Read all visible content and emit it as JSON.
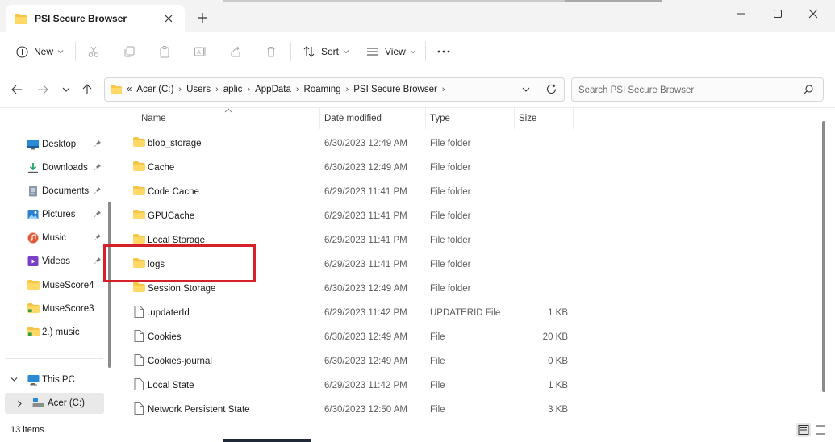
{
  "window": {
    "tab_title": "PSI Secure Browser"
  },
  "toolbar": {
    "new_label": "New",
    "sort_label": "Sort",
    "view_label": "View"
  },
  "address": {
    "overflow": "«",
    "crumbs": [
      "Acer (C:)",
      "Users",
      "aplic",
      "AppData",
      "Roaming",
      "PSI Secure Browser"
    ]
  },
  "search": {
    "placeholder": "Search PSI Secure Browser"
  },
  "sidebar": {
    "quick_access": [
      {
        "label": "Desktop",
        "icon": "desktop-icon",
        "pinned": true
      },
      {
        "label": "Downloads",
        "icon": "downloads-icon",
        "pinned": true
      },
      {
        "label": "Documents",
        "icon": "documents-icon",
        "pinned": true
      },
      {
        "label": "Pictures",
        "icon": "pictures-icon",
        "pinned": true
      },
      {
        "label": "Music",
        "icon": "music-icon",
        "pinned": true
      },
      {
        "label": "Videos",
        "icon": "videos-icon",
        "pinned": true
      },
      {
        "label": "MuseScore4",
        "icon": "folder-icon",
        "pinned": false
      },
      {
        "label": "MuseScore3",
        "icon": "folder-icon",
        "pinned": false
      },
      {
        "label": "2.) music",
        "icon": "folder-icon",
        "pinned": false
      }
    ],
    "this_pc": "This PC",
    "drive": "Acer (C:)"
  },
  "columns": {
    "name": "Name",
    "date": "Date modified",
    "type": "Type",
    "size": "Size"
  },
  "files": [
    {
      "name": "blob_storage",
      "date": "6/30/2023 12:49 AM",
      "type": "File folder",
      "size": "",
      "kind": "folder"
    },
    {
      "name": "Cache",
      "date": "6/30/2023 12:49 AM",
      "type": "File folder",
      "size": "",
      "kind": "folder"
    },
    {
      "name": "Code Cache",
      "date": "6/29/2023 11:41 PM",
      "type": "File folder",
      "size": "",
      "kind": "folder"
    },
    {
      "name": "GPUCache",
      "date": "6/29/2023 11:41 PM",
      "type": "File folder",
      "size": "",
      "kind": "folder"
    },
    {
      "name": "Local Storage",
      "date": "6/29/2023 11:41 PM",
      "type": "File folder",
      "size": "",
      "kind": "folder"
    },
    {
      "name": "logs",
      "date": "6/29/2023 11:41 PM",
      "type": "File folder",
      "size": "",
      "kind": "folder"
    },
    {
      "name": "Session Storage",
      "date": "6/30/2023 12:49 AM",
      "type": "File folder",
      "size": "",
      "kind": "folder"
    },
    {
      "name": ".updaterId",
      "date": "6/29/2023 11:42 PM",
      "type": "UPDATERID File",
      "size": "1 KB",
      "kind": "file"
    },
    {
      "name": "Cookies",
      "date": "6/30/2023 12:49 AM",
      "type": "File",
      "size": "20 KB",
      "kind": "file"
    },
    {
      "name": "Cookies-journal",
      "date": "6/30/2023 12:49 AM",
      "type": "File",
      "size": "0 KB",
      "kind": "file"
    },
    {
      "name": "Local State",
      "date": "6/29/2023 11:42 PM",
      "type": "File",
      "size": "1 KB",
      "kind": "file"
    },
    {
      "name": "Network Persistent State",
      "date": "6/30/2023 12:50 AM",
      "type": "File",
      "size": "3 KB",
      "kind": "file"
    }
  ],
  "status": {
    "item_count": "13 items"
  },
  "colors": {
    "folder": "#f6c343",
    "highlight": "#d4212a",
    "accent": "#0067c0"
  }
}
